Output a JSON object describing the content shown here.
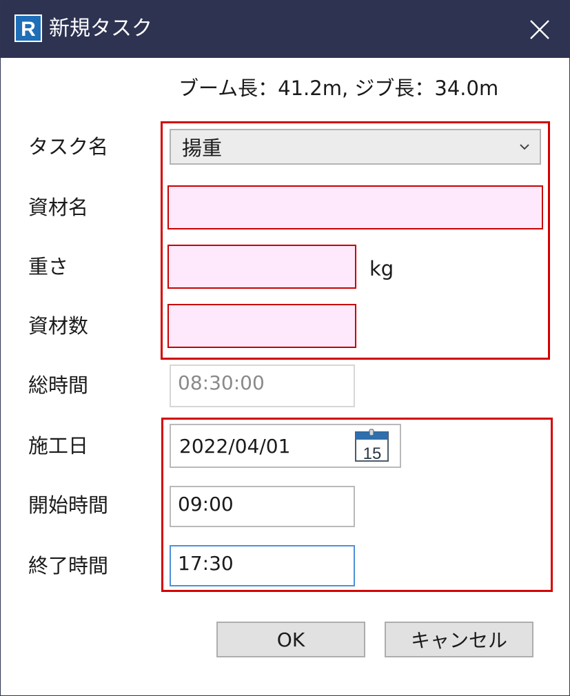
{
  "window": {
    "title": "新規タスク",
    "app_icon_letter": "R"
  },
  "info": {
    "text": "ブーム長：41.2m,  ジブ長：34.0m"
  },
  "labels": {
    "task_name": "タスク名",
    "material_name": "資材名",
    "weight": "重さ",
    "material_count": "資材数",
    "total_time": "総時間",
    "work_date": "施工日",
    "start_time": "開始時間",
    "end_time": "終了時間"
  },
  "fields": {
    "task_name": "揚重",
    "material_name": "",
    "weight": "",
    "weight_unit": "kg",
    "material_count": "",
    "total_time": "08:30:00",
    "work_date": "2022/04/01",
    "calendar_day": "15",
    "start_time": "09:00",
    "end_time": "17:30"
  },
  "buttons": {
    "ok": "OK",
    "cancel": "キャンセル"
  },
  "colors": {
    "titlebar": "#2e3351",
    "highlight_border": "#d40000",
    "required_fill": "#fde8fc",
    "focus_border": "#4a90d9"
  },
  "icons": {
    "app": "revit-r-icon",
    "close": "close-icon",
    "dropdown": "chevron-down-icon",
    "calendar": "calendar-icon"
  }
}
